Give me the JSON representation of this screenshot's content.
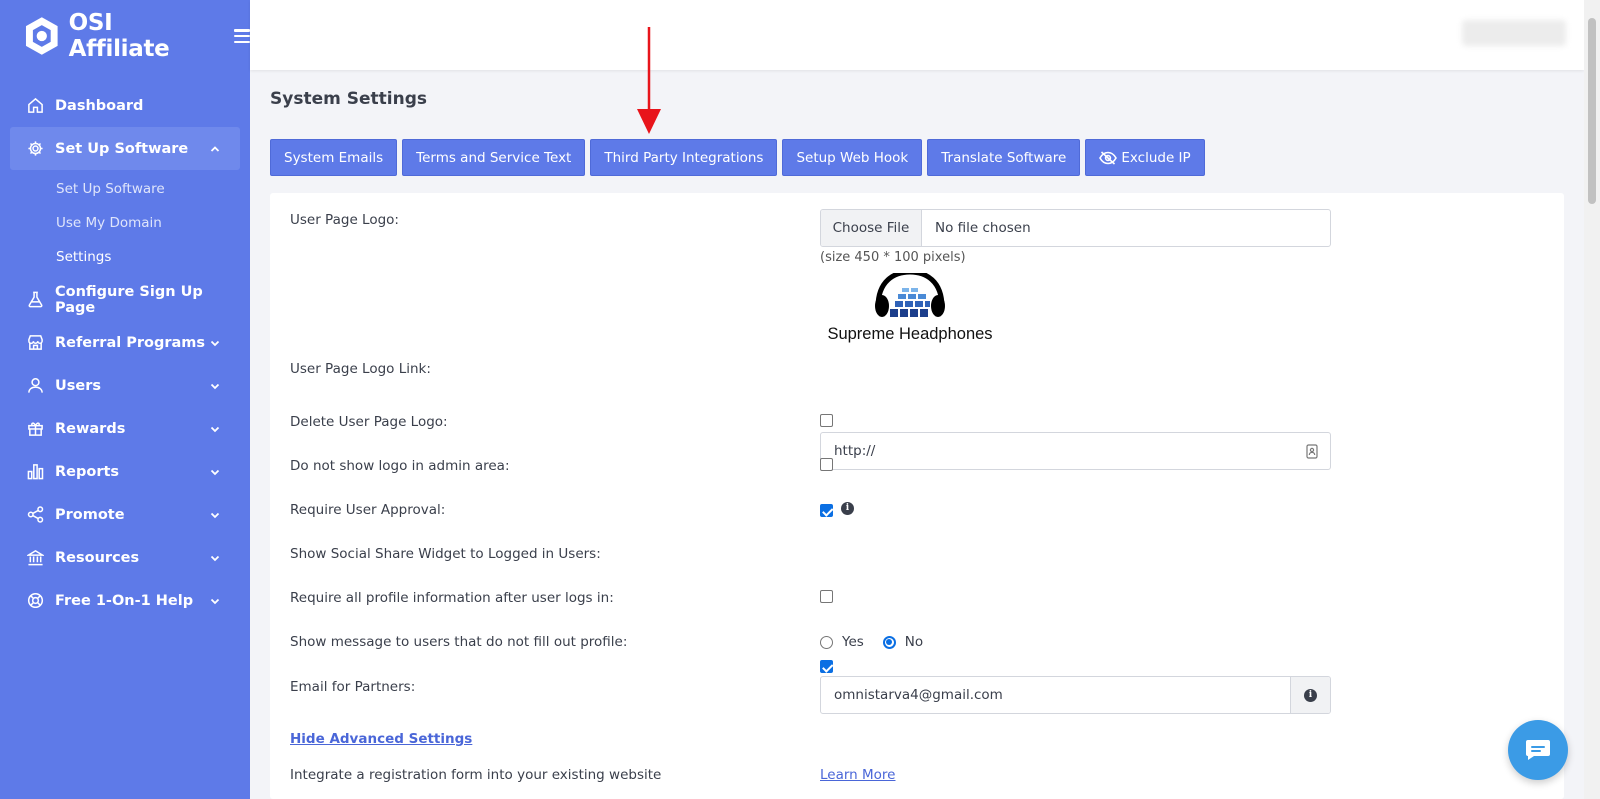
{
  "app": {
    "brand_name": "OSI Affiliate"
  },
  "sidebar": {
    "items": [
      {
        "label": "Dashboard",
        "icon": "home-icon"
      },
      {
        "label": "Set Up Software",
        "icon": "gear-icon",
        "expanded": true,
        "children": [
          {
            "label": "Set Up Software"
          },
          {
            "label": "Use My Domain"
          },
          {
            "label": "Settings",
            "current": true
          }
        ]
      },
      {
        "label": "Configure Sign Up Page",
        "icon": "flask-icon"
      },
      {
        "label": "Referral Programs",
        "icon": "store-icon"
      },
      {
        "label": "Users",
        "icon": "user-icon"
      },
      {
        "label": "Rewards",
        "icon": "gift-icon"
      },
      {
        "label": "Reports",
        "icon": "bar-chart-icon"
      },
      {
        "label": "Promote",
        "icon": "share-icon"
      },
      {
        "label": "Resources",
        "icon": "bank-icon"
      },
      {
        "label": "Free 1-On-1 Help",
        "icon": "lifebuoy-icon"
      }
    ]
  },
  "main": {
    "title": "System Settings",
    "tabs": [
      {
        "label": "System Emails"
      },
      {
        "label": "Terms and Service Text"
      },
      {
        "label": "Third Party Integrations"
      },
      {
        "label": "Setup Web Hook"
      },
      {
        "label": "Translate Software"
      },
      {
        "label": "Exclude IP",
        "icon": "eye-slash-icon"
      }
    ]
  },
  "form": {
    "user_page_logo": {
      "label": "User Page Logo:",
      "button_label": "Choose File",
      "status": "No file chosen",
      "hint": "(size 450 * 100 pixels)",
      "logo_caption": "Supreme Headphones"
    },
    "user_page_logo_link": {
      "label": "User Page Logo Link:",
      "value": "http://"
    },
    "delete_logo": {
      "label": "Delete User Page Logo:",
      "checked": false
    },
    "hide_logo_admin": {
      "label": "Do not show logo in admin area:",
      "checked": false
    },
    "require_approval": {
      "label": "Require User Approval:",
      "checked": true
    },
    "social_share": {
      "label": "Show Social Share Widget to Logged in Users:",
      "checked": true
    },
    "require_profile": {
      "label": "Require all profile information after user logs in:",
      "checked": false
    },
    "show_message": {
      "label": "Show message to users that do not fill out profile:",
      "options": [
        "Yes",
        "No"
      ],
      "selected": "No"
    },
    "partner_email": {
      "label": "Email for Partners:",
      "value": "omnistarva4@gmail.com"
    },
    "advanced_link": "Hide Advanced Settings",
    "integrate": {
      "label": "Integrate a registration form into your existing website",
      "link": "Learn More"
    }
  },
  "colors": {
    "sidebar_bg": "#5e7ae8",
    "button_bg": "#5e7ae8",
    "arrow": "#e8141b",
    "chat_bg": "#3b9be6"
  }
}
